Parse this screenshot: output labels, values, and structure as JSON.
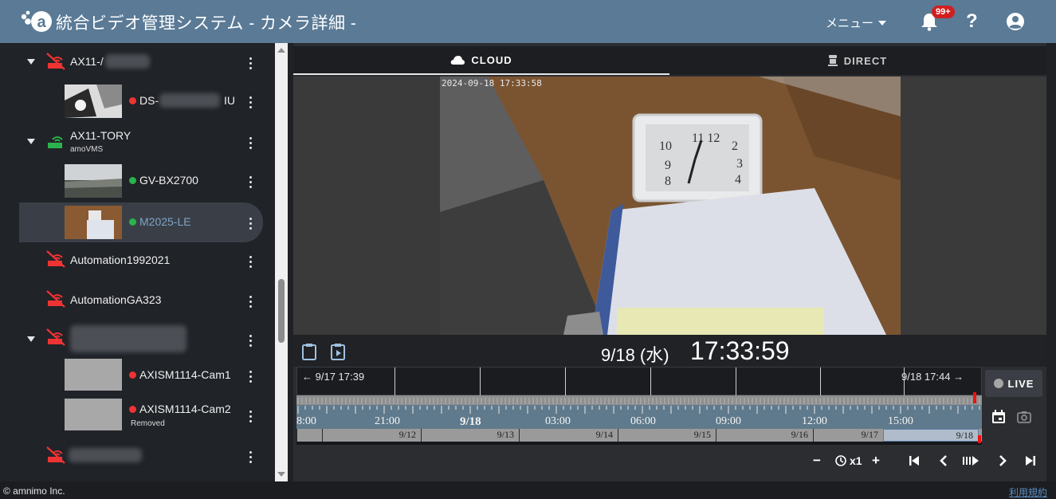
{
  "header": {
    "title": "統合ビデオ管理システム  - カメラ詳細 -",
    "menu_label": "メニュー",
    "notification_badge": "99+",
    "help_label": "?"
  },
  "sidebar": {
    "items": [
      {
        "label": "AX11-/",
        "type": "router",
        "status": "offline",
        "expanded": true
      },
      {
        "label": "DS-",
        "label_suffix": "IU",
        "type": "camera",
        "status": "offline"
      },
      {
        "label": "AX11-TORY",
        "sub": "amoVMS",
        "type": "router",
        "status": "online",
        "expanded": true
      },
      {
        "label": "GV-BX2700",
        "type": "camera",
        "status": "online"
      },
      {
        "label": "M2025-LE",
        "type": "camera",
        "status": "online",
        "selected": true
      },
      {
        "label": "Automation1992021",
        "type": "router",
        "status": "offline"
      },
      {
        "label": "AutomationGA323",
        "type": "router",
        "status": "offline"
      },
      {
        "label": "",
        "type": "router",
        "status": "offline",
        "expanded": true
      },
      {
        "label": "AXISM1114-Cam1",
        "type": "camera",
        "status": "offline"
      },
      {
        "label": "AXISM1114-Cam2",
        "sub": "Removed",
        "type": "camera",
        "status": "offline"
      },
      {
        "label": "",
        "type": "router",
        "status": "offline"
      }
    ]
  },
  "tabs": [
    {
      "label": "CLOUD",
      "icon": "cloud-icon",
      "active": true
    },
    {
      "label": "DIRECT",
      "icon": "camera-icon",
      "active": false
    }
  ],
  "video": {
    "timestamp": "2024-09-18 17:33:58"
  },
  "current": {
    "date": "9/18 (水)",
    "time": "17:33:59"
  },
  "timeline": {
    "range_start": "9/17 17:39",
    "range_end": "9/18 17:44",
    "hours": [
      "8:00",
      "21:00",
      "9/18",
      "03:00",
      "06:00",
      "09:00",
      "12:00",
      "15:00"
    ],
    "days": [
      "9/12",
      "9/13",
      "9/14",
      "9/15",
      "9/16",
      "9/17",
      "9/18"
    ],
    "active_day": "9/18"
  },
  "live_label": "LIVE",
  "playback": {
    "speed": "x1",
    "minus": "−",
    "plus": "+"
  },
  "footer": {
    "copyright": "© amnimo Inc.",
    "terms": "利用規約"
  },
  "colors": {
    "header": "#5a7a96",
    "offline": "#e33333",
    "online": "#2bb24c",
    "accent_link": "#5b8fc2"
  }
}
